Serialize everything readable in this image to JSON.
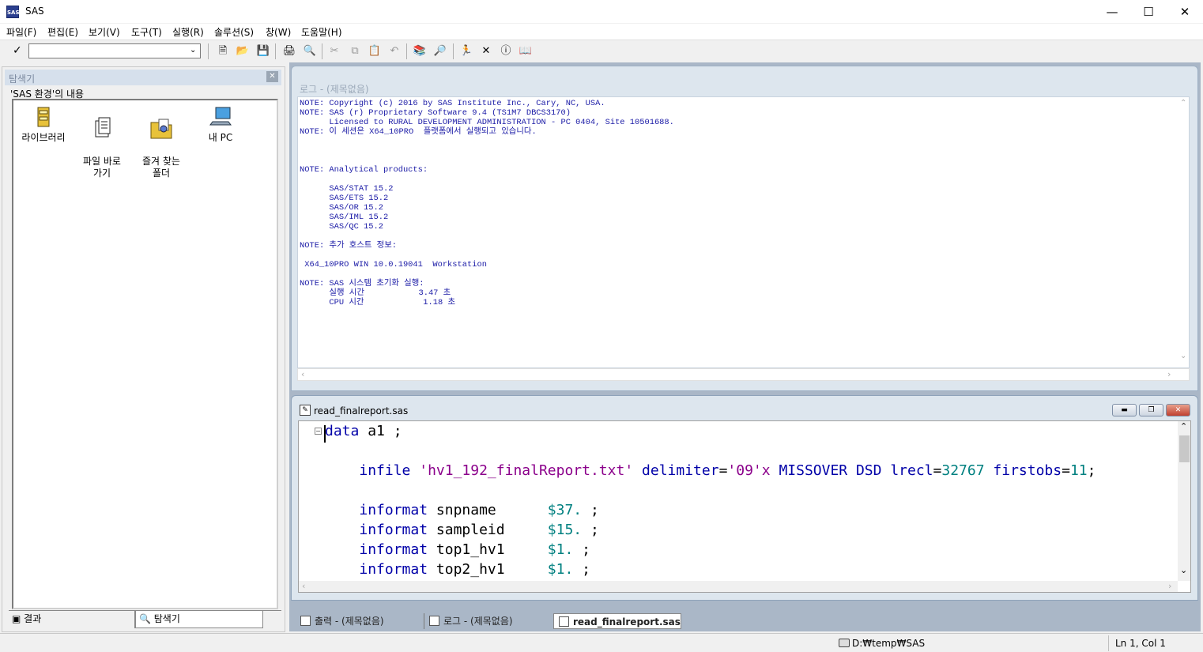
{
  "window": {
    "title": "SAS",
    "app_icon": "SAS"
  },
  "menu": [
    "파일(F)",
    "편집(E)",
    "보기(V)",
    "도구(T)",
    "실행(R)",
    "솔루션(S)",
    "창(W)",
    "도움말(H)"
  ],
  "toolbar": {
    "command_value": ""
  },
  "explorer": {
    "title": "탐색기",
    "caption": "'SAS 환경'의 내용",
    "items": [
      {
        "label": "라이브러리",
        "icon": "library-icon"
      },
      {
        "label": "파일 바로\n가기",
        "icon": "file-shortcut-icon"
      },
      {
        "label": "즐겨 찾는\n폴더",
        "icon": "favorite-folder-icon"
      },
      {
        "label": "내 PC",
        "icon": "my-pc-icon"
      }
    ],
    "tabs": [
      "결과",
      "탐색기"
    ]
  },
  "log": {
    "title": "로그 - (제목없음)",
    "text": "NOTE: Copyright (c) 2016 by SAS Institute Inc., Cary, NC, USA.\nNOTE: SAS (r) Proprietary Software 9.4 (TS1M7 DBCS3170)\n      Licensed to RURAL DEVELOPMENT ADMINISTRATION - PC 0404, Site 10501688.\nNOTE: 이 세션은 X64_10PRO  플랫폼에서 실행되고 있습니다.\n\n\n\nNOTE: Analytical products:\n\n      SAS/STAT 15.2\n      SAS/ETS 15.2\n      SAS/OR 15.2\n      SAS/IML 15.2\n      SAS/QC 15.2\n\nNOTE: 추가 호스트 정보:\n\n X64_10PRO WIN 10.0.19041  Workstation\n\nNOTE: SAS 시스템 초기화 실행:\n      실행 시간           3.47 초\n      CPU 시간            1.18 초"
  },
  "editor": {
    "title": "read_finalreport.sas",
    "lines": [
      {
        "indent": "",
        "parts": [
          {
            "t": "kw",
            "v": "data"
          },
          {
            "t": "plain",
            "v": " a1 ;"
          }
        ]
      },
      {
        "indent": "",
        "parts": []
      },
      {
        "indent": "    ",
        "parts": [
          {
            "t": "kw",
            "v": "infile"
          },
          {
            "t": "plain",
            "v": " "
          },
          {
            "t": "str",
            "v": "'hv1_192_finalReport.txt'"
          },
          {
            "t": "plain",
            "v": " "
          },
          {
            "t": "kw",
            "v": "delimiter"
          },
          {
            "t": "plain",
            "v": "="
          },
          {
            "t": "str",
            "v": "'09'x"
          },
          {
            "t": "plain",
            "v": " "
          },
          {
            "t": "kw",
            "v": "MISSOVER DSD lrecl"
          },
          {
            "t": "plain",
            "v": "="
          },
          {
            "t": "num",
            "v": "32767"
          },
          {
            "t": "plain",
            "v": " "
          },
          {
            "t": "kw",
            "v": "firstobs"
          },
          {
            "t": "plain",
            "v": "="
          },
          {
            "t": "num",
            "v": "11"
          },
          {
            "t": "plain",
            "v": ";"
          }
        ]
      },
      {
        "indent": "",
        "parts": []
      },
      {
        "indent": "    ",
        "parts": [
          {
            "t": "kw",
            "v": "informat"
          },
          {
            "t": "plain",
            "v": " snpname      "
          },
          {
            "t": "num",
            "v": "$37."
          },
          {
            "t": "plain",
            "v": " ;"
          }
        ]
      },
      {
        "indent": "    ",
        "parts": [
          {
            "t": "kw",
            "v": "informat"
          },
          {
            "t": "plain",
            "v": " sampleid     "
          },
          {
            "t": "num",
            "v": "$15."
          },
          {
            "t": "plain",
            "v": " ;"
          }
        ]
      },
      {
        "indent": "    ",
        "parts": [
          {
            "t": "kw",
            "v": "informat"
          },
          {
            "t": "plain",
            "v": " top1_hv1     "
          },
          {
            "t": "num",
            "v": "$1."
          },
          {
            "t": "plain",
            "v": " ;"
          }
        ]
      },
      {
        "indent": "    ",
        "parts": [
          {
            "t": "kw",
            "v": "informat"
          },
          {
            "t": "plain",
            "v": " top2_hv1     "
          },
          {
            "t": "num",
            "v": "$1."
          },
          {
            "t": "plain",
            "v": " ;"
          }
        ]
      }
    ]
  },
  "window_tabs": [
    "출력 - (제목없음)",
    "로그 - (제목없음)",
    "read_finalreport.sas"
  ],
  "status": {
    "path": "D:₩temp₩SAS",
    "position": "Ln 1, Col 1"
  },
  "colors": {
    "keyword": "#0000a8",
    "string": "#8b008b",
    "number": "#008080",
    "log_text": "#1a1aa6",
    "mdi_bg": "#aab7c7"
  }
}
